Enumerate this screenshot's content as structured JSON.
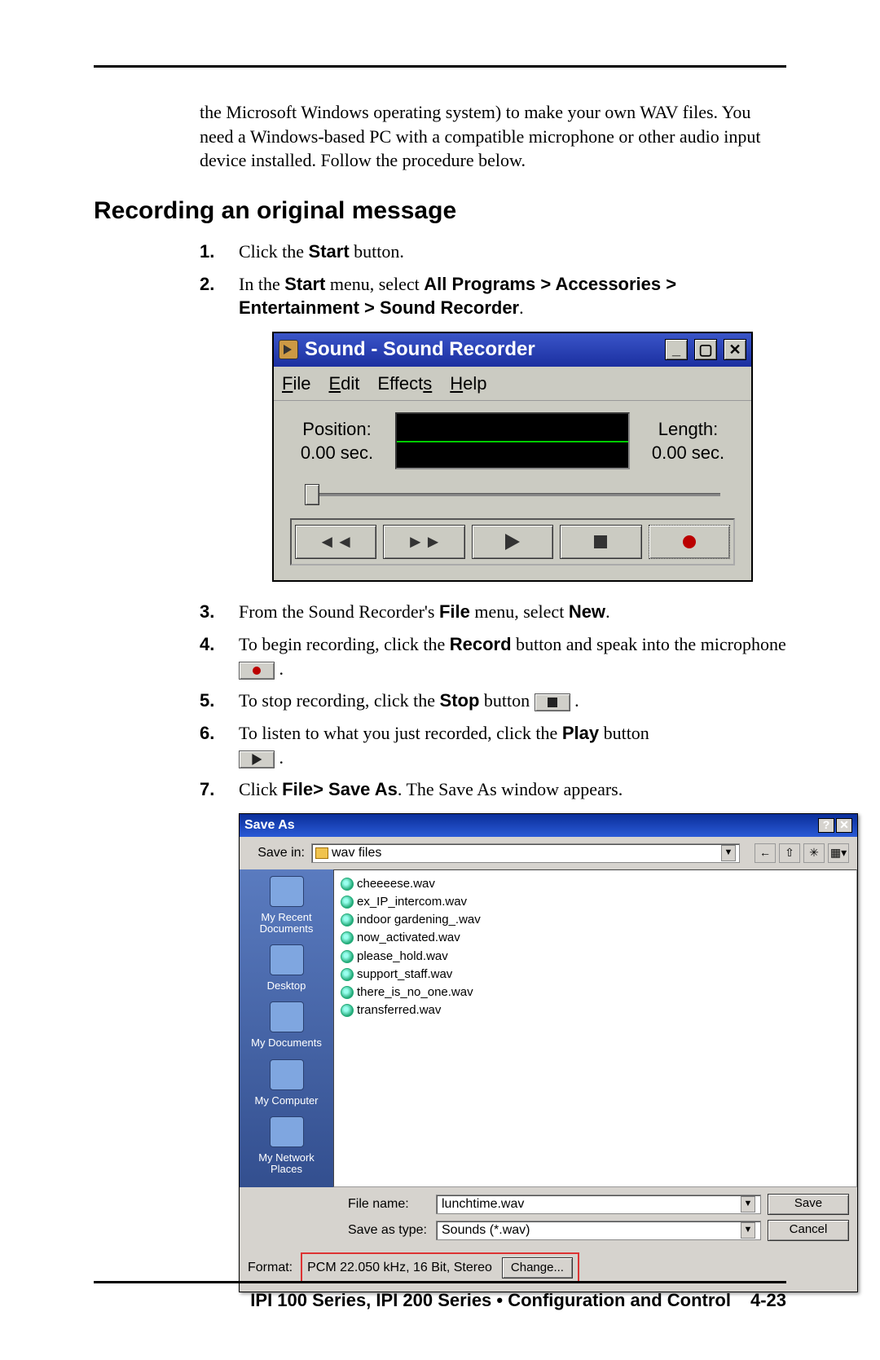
{
  "intro": "the Microsoft Windows operating system) to make your own WAV files. You need a Windows-based PC with a compatible microphone or other audio input device installed.  Follow the procedure below.",
  "section_title": "Recording an original message",
  "steps": {
    "s1_a": "Click the ",
    "s1_b": "Start",
    "s1_c": " button.",
    "s2_a": "In the ",
    "s2_b": "Start",
    "s2_c": " menu, select ",
    "s2_d": "All Programs > Accessories > Entertainment > Sound Recorder",
    "s2_e": ".",
    "s3_a": "From the Sound Recorder's ",
    "s3_b": "File",
    "s3_c": " menu, select ",
    "s3_d": "New",
    "s3_e": ".",
    "s4_a": "To begin recording, click the ",
    "s4_b": "Record",
    "s4_c": " button and speak into the microphone ",
    "s5_a": "To stop recording, click the ",
    "s5_b": "Stop",
    "s5_c": " button ",
    "s6_a": "To listen to what you just recorded, click the ",
    "s6_b": "Play",
    "s6_c": " button",
    "s7_a": "Click ",
    "s7_b": "File> Save As",
    "s7_c": ".  The Save As window appears."
  },
  "sr": {
    "title": "Sound - Sound Recorder",
    "menu": {
      "file": "File",
      "edit": "Edit",
      "effects": "Effects",
      "help": "Help"
    },
    "pos_label": "Position:",
    "pos_value": "0.00 sec.",
    "len_label": "Length:",
    "len_value": "0.00 sec."
  },
  "sa": {
    "title": "Save As",
    "savein_label": "Save in:",
    "savein_value": "wav files",
    "side": {
      "recent": "My Recent Documents",
      "desktop": "Desktop",
      "mydocs": "My Documents",
      "mycomp": "My Computer",
      "mynet": "My Network Places"
    },
    "files": [
      "cheeeese.wav",
      "ex_IP_intercom.wav",
      "indoor gardening_.wav",
      "now_activated.wav",
      "please_hold.wav",
      "support_staff.wav",
      "there_is_no_one.wav",
      "transferred.wav"
    ],
    "filename_label": "File name:",
    "filename_value": "lunchtime.wav",
    "savetype_label": "Save as type:",
    "savetype_value": "Sounds (*.wav)",
    "save_btn": "Save",
    "cancel_btn": "Cancel",
    "format_label": "Format:",
    "format_value": "PCM 22.050 kHz, 16 Bit, Stereo",
    "change_btn": "Change..."
  },
  "footer": {
    "text": "IPI 100 Series, IPI 200 Series • Configuration and Control",
    "page": "4-23"
  }
}
